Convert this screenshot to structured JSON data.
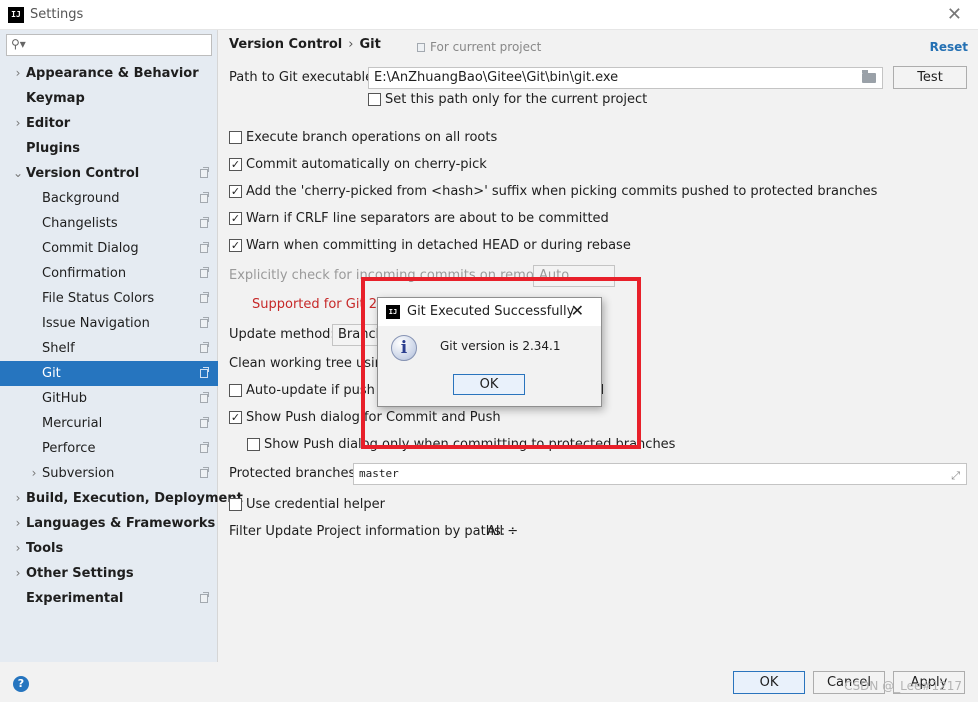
{
  "window": {
    "title": "Settings",
    "app_icon_text": "IJ"
  },
  "sidebar": {
    "search_placeholder": "",
    "items": [
      {
        "label": "Appearance & Behavior",
        "level": 0,
        "bold": true,
        "chevron": "right",
        "project_icon": false
      },
      {
        "label": "Keymap",
        "level": 0,
        "bold": true,
        "chevron": "",
        "project_icon": false
      },
      {
        "label": "Editor",
        "level": 0,
        "bold": true,
        "chevron": "right",
        "project_icon": false
      },
      {
        "label": "Plugins",
        "level": 0,
        "bold": true,
        "chevron": "",
        "project_icon": false
      },
      {
        "label": "Version Control",
        "level": 0,
        "bold": true,
        "chevron": "down",
        "project_icon": true
      },
      {
        "label": "Background",
        "level": 1,
        "bold": false,
        "chevron": "",
        "project_icon": true
      },
      {
        "label": "Changelists",
        "level": 1,
        "bold": false,
        "chevron": "",
        "project_icon": true
      },
      {
        "label": "Commit Dialog",
        "level": 1,
        "bold": false,
        "chevron": "",
        "project_icon": true
      },
      {
        "label": "Confirmation",
        "level": 1,
        "bold": false,
        "chevron": "",
        "project_icon": true
      },
      {
        "label": "File Status Colors",
        "level": 1,
        "bold": false,
        "chevron": "",
        "project_icon": true
      },
      {
        "label": "Issue Navigation",
        "level": 1,
        "bold": false,
        "chevron": "",
        "project_icon": true
      },
      {
        "label": "Shelf",
        "level": 1,
        "bold": false,
        "chevron": "",
        "project_icon": true
      },
      {
        "label": "Git",
        "level": 1,
        "bold": false,
        "chevron": "",
        "project_icon": true,
        "selected": true
      },
      {
        "label": "GitHub",
        "level": 1,
        "bold": false,
        "chevron": "",
        "project_icon": true
      },
      {
        "label": "Mercurial",
        "level": 1,
        "bold": false,
        "chevron": "",
        "project_icon": true
      },
      {
        "label": "Perforce",
        "level": 1,
        "bold": false,
        "chevron": "",
        "project_icon": true
      },
      {
        "label": "Subversion",
        "level": 1,
        "bold": false,
        "chevron": "right",
        "project_icon": true
      },
      {
        "label": "Build, Execution, Deployment",
        "level": 0,
        "bold": true,
        "chevron": "right",
        "project_icon": false
      },
      {
        "label": "Languages & Frameworks",
        "level": 0,
        "bold": true,
        "chevron": "right",
        "project_icon": false
      },
      {
        "label": "Tools",
        "level": 0,
        "bold": true,
        "chevron": "right",
        "project_icon": false
      },
      {
        "label": "Other Settings",
        "level": 0,
        "bold": true,
        "chevron": "right",
        "project_icon": false
      },
      {
        "label": "Experimental",
        "level": 0,
        "bold": true,
        "chevron": "",
        "project_icon": true
      }
    ]
  },
  "header": {
    "crumb1": "Version Control",
    "crumb_sep": "›",
    "crumb2": "Git",
    "scope": "For current project",
    "reset": "Reset"
  },
  "git_path": {
    "label": "Path to Git executable:",
    "value": "E:\\AnZhuangBao\\Gitee\\Git\\bin\\git.exe",
    "test_button": "Test",
    "project_only": "Set this path only for the current project"
  },
  "options": {
    "branch_ops": "Execute branch operations on all roots",
    "commit_cherry": "Commit automatically on cherry-pick",
    "cherry_suffix": "Add the 'cherry-picked from <hash>' suffix when picking commits pushed to protected branches",
    "warn_crlf": "Warn if CRLF line separators are about to be committed",
    "warn_detached": "Warn when committing in detached HEAD or during rebase",
    "explicit_check": "Explicitly check for incoming commits on remotes:",
    "explicit_value": "Auto",
    "supported": "Supported for Git 2.9",
    "update_method_label": "Update method:",
    "update_method_value": "Branch default",
    "clean_tree": "Clean working tree using:",
    "auto_update": "Auto-update if push of the current branch was rejected",
    "show_push": "Show Push dialog for Commit and Push",
    "show_push_protected": "Show Push dialog only when committing to protected branches",
    "protected_label": "Protected branches:",
    "protected_value": "master",
    "credential": "Use credential helper",
    "filter_label": "Filter Update Project information by paths:",
    "filter_value": "All ÷"
  },
  "footer": {
    "help": "?",
    "ok": "OK",
    "cancel": "Cancel",
    "apply": "Apply",
    "watermark": "CSDN @_Lee#1217"
  },
  "dialog": {
    "title": "Git Executed Successfully",
    "icon_text": "IJ",
    "message": "Git version is 2.34.1",
    "ok": "OK",
    "info_glyph": "i"
  },
  "colors": {
    "selection": "#2675bf",
    "highlight": "#e8202a",
    "error": "#c62828",
    "link": "#2470b3"
  }
}
